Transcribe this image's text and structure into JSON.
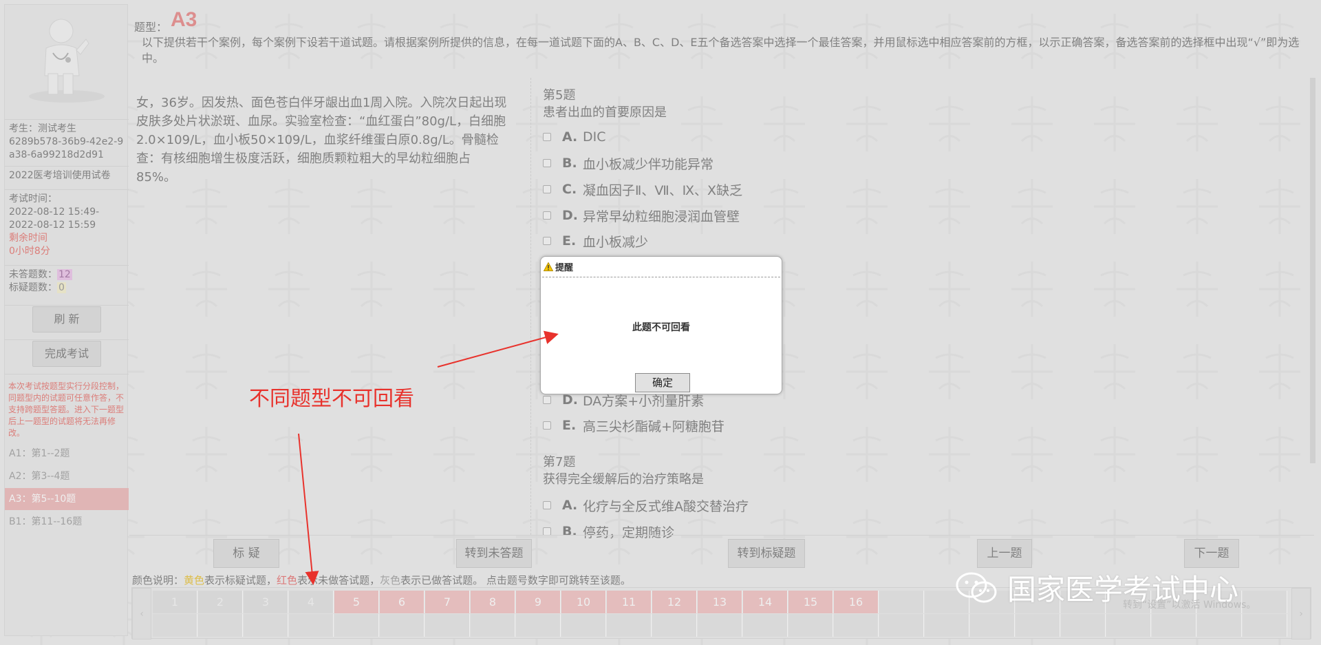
{
  "sidebar": {
    "examinee_label": "考生：测试考生",
    "examinee_id": "6289b578-36b9-42e2-9a38-6a99218d2d91",
    "exam_name": "2022医考培训使用试卷",
    "exam_time_label": "考试时间：",
    "exam_start": "2022-08-12 15:49-",
    "exam_end": "2022-08-12 15:59",
    "remaining_label": "剩余时间",
    "remaining_value": "0小时8分",
    "unanswered_label": "未答题数：",
    "unanswered_count": "12",
    "flagged_label": "标疑题数：",
    "flagged_count": "0",
    "refresh_button": "刷 新",
    "finish_button": "完成考试",
    "note": "本次考试按题型实行分段控制，同题型内的试题可任意作答，不支持跨题型答题。进入下一题型后上一题型的试题将无法再修改。",
    "sections": [
      {
        "label": "A1：第1--2题"
      },
      {
        "label": "A2：第3--4题"
      },
      {
        "label": "A3：第5--10题"
      },
      {
        "label": "B1：第11--16题"
      }
    ]
  },
  "header": {
    "qtype_label": "题型：",
    "qtype_value": "A3",
    "instructions": "以下提供若干个案例，每个案例下设若干道试题。请根据案例所提供的信息，在每一道试题下面的A、B、C、D、E五个备选答案中选择一个最佳答案，并用鼠标选中相应答案前的方框，以示正确答案，备选答案前的选择框中出现“√”即为选中。"
  },
  "case_text": "女，36岁。因发热、面色苍白伴牙龈出血1周入院。入院次日起出现皮肤多处片状淤斑、血尿。实验室检查：“血红蛋白”80g/L，白细胞2.0×109/L，血小板50×109/L，血浆纤维蛋白原0.8g/L。骨髓检查：有核细胞增生极度活跃，细胞质颗粒粗大的早幼粒细胞占85%。",
  "questions": {
    "q5": {
      "title": "第5题",
      "stem": "患者出血的首要原因是",
      "options": [
        {
          "letter": "A.",
          "text": "DIC"
        },
        {
          "letter": "B.",
          "text": "血小板减少伴功能异常"
        },
        {
          "letter": "C.",
          "text": "凝血因子Ⅱ、Ⅶ、Ⅸ、Ⅹ缺乏"
        },
        {
          "letter": "D.",
          "text": "异常早幼粒细胞浸润血管壁"
        },
        {
          "letter": "E.",
          "text": "血小板减少"
        }
      ]
    },
    "q6_partial": [
      {
        "letter": "D.",
        "text": "DA方案+小剂量肝素"
      },
      {
        "letter": "E.",
        "text": "高三尖杉酯碱+阿糖胞苷"
      }
    ],
    "q7": {
      "title": "第7题",
      "stem": "获得完全缓解后的治疗策略是",
      "options": [
        {
          "letter": "A.",
          "text": "化疗与全反式维A酸交替治疗"
        },
        {
          "letter": "B.",
          "text": "停药，定期随诊"
        }
      ]
    }
  },
  "buttons": {
    "flag": "标 疑",
    "goto_unanswered": "转到未答题",
    "goto_flagged": "转到标疑题",
    "prev": "上一题",
    "next": "下一题"
  },
  "legend": {
    "prefix": "颜色说明：",
    "yellow": "黄色",
    "yellow_desc": "表示标疑试题，",
    "red": "红色",
    "red_desc": "表示未做答试题，",
    "grey": "灰色",
    "grey_desc": "表示已做答试题。 点击题号数字即可跳转至该题。"
  },
  "grid": {
    "prev_arrow": "‹",
    "next_arrow": "›",
    "cells": [
      {
        "num": "1",
        "status": "answered"
      },
      {
        "num": "2",
        "status": "answered"
      },
      {
        "num": "3",
        "status": "answered"
      },
      {
        "num": "4",
        "status": "answered"
      },
      {
        "num": "5",
        "status": "unanswered"
      },
      {
        "num": "6",
        "status": "unanswered"
      },
      {
        "num": "7",
        "status": "unanswered"
      },
      {
        "num": "8",
        "status": "unanswered"
      },
      {
        "num": "9",
        "status": "unanswered"
      },
      {
        "num": "10",
        "status": "unanswered"
      },
      {
        "num": "11",
        "status": "unanswered"
      },
      {
        "num": "12",
        "status": "unanswered"
      },
      {
        "num": "13",
        "status": "unanswered"
      },
      {
        "num": "14",
        "status": "unanswered"
      },
      {
        "num": "15",
        "status": "unanswered"
      },
      {
        "num": "16",
        "status": "unanswered"
      }
    ]
  },
  "dialog": {
    "title": "提醒",
    "message": "此题不可回看",
    "ok_button": "确定",
    "icon": "warning-icon"
  },
  "annotation": {
    "text": "不同题型不可回看",
    "color": "#e8322c"
  },
  "watermark": {
    "text": "国家医学考试中心",
    "windows_text": "转到“设置”以激活 Windows。"
  },
  "colors": {
    "accent_red": "#e26a6a",
    "unanswered": "#eeb3b3",
    "answered": "#d9d9d9",
    "active_section": "#e9a6a6"
  }
}
